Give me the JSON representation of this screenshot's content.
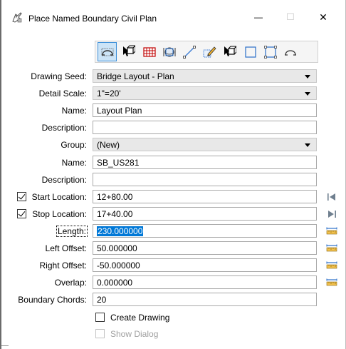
{
  "window": {
    "title": "Place Named Boundary Civil Plan",
    "minimize_glyph": "—",
    "maximize_glyph": "☐",
    "close_glyph": "✕"
  },
  "toolbar": {
    "tools": [
      {
        "icon": "civil-plan-icon",
        "active": true
      },
      {
        "icon": "two-points-icon"
      },
      {
        "icon": "grid-icon"
      },
      {
        "icon": "from-view-icon"
      },
      {
        "icon": "line-icon"
      },
      {
        "icon": "element-icon"
      },
      {
        "icon": "select-element-icon"
      },
      {
        "icon": "rectangle-icon"
      },
      {
        "icon": "polygon-icon"
      },
      {
        "icon": "civil-profile-icon"
      }
    ]
  },
  "form": {
    "drawing_seed": {
      "label": "Drawing Seed:",
      "value": "Bridge Layout - Plan"
    },
    "detail_scale": {
      "label": "Detail Scale:",
      "value": "1\"=20'"
    },
    "name1": {
      "label": "Name:",
      "value": "Layout Plan"
    },
    "description1": {
      "label": "Description:",
      "value": ""
    },
    "group": {
      "label": "Group:",
      "value": "(New)"
    },
    "name2": {
      "label": "Name:",
      "value": "SB_US281"
    },
    "description2": {
      "label": "Description:",
      "value": ""
    },
    "start_location": {
      "label": "Start Location:",
      "value": "12+80.00",
      "checked": true
    },
    "stop_location": {
      "label": "Stop Location:",
      "value": "17+40.00",
      "checked": true
    },
    "length": {
      "label": "Length:",
      "value": "230.000000"
    },
    "left_offset": {
      "label": "Left Offset:",
      "value": "50.000000"
    },
    "right_offset": {
      "label": "Right Offset:",
      "value": "-50.000000"
    },
    "overlap": {
      "label": "Overlap:",
      "value": "0.000000"
    },
    "boundary_chords": {
      "label": "Boundary Chords:",
      "value": "20"
    },
    "create_drawing": {
      "label": "Create Drawing",
      "checked": false
    },
    "show_dialog": {
      "label": "Show Dialog",
      "checked": false,
      "disabled": true
    }
  }
}
